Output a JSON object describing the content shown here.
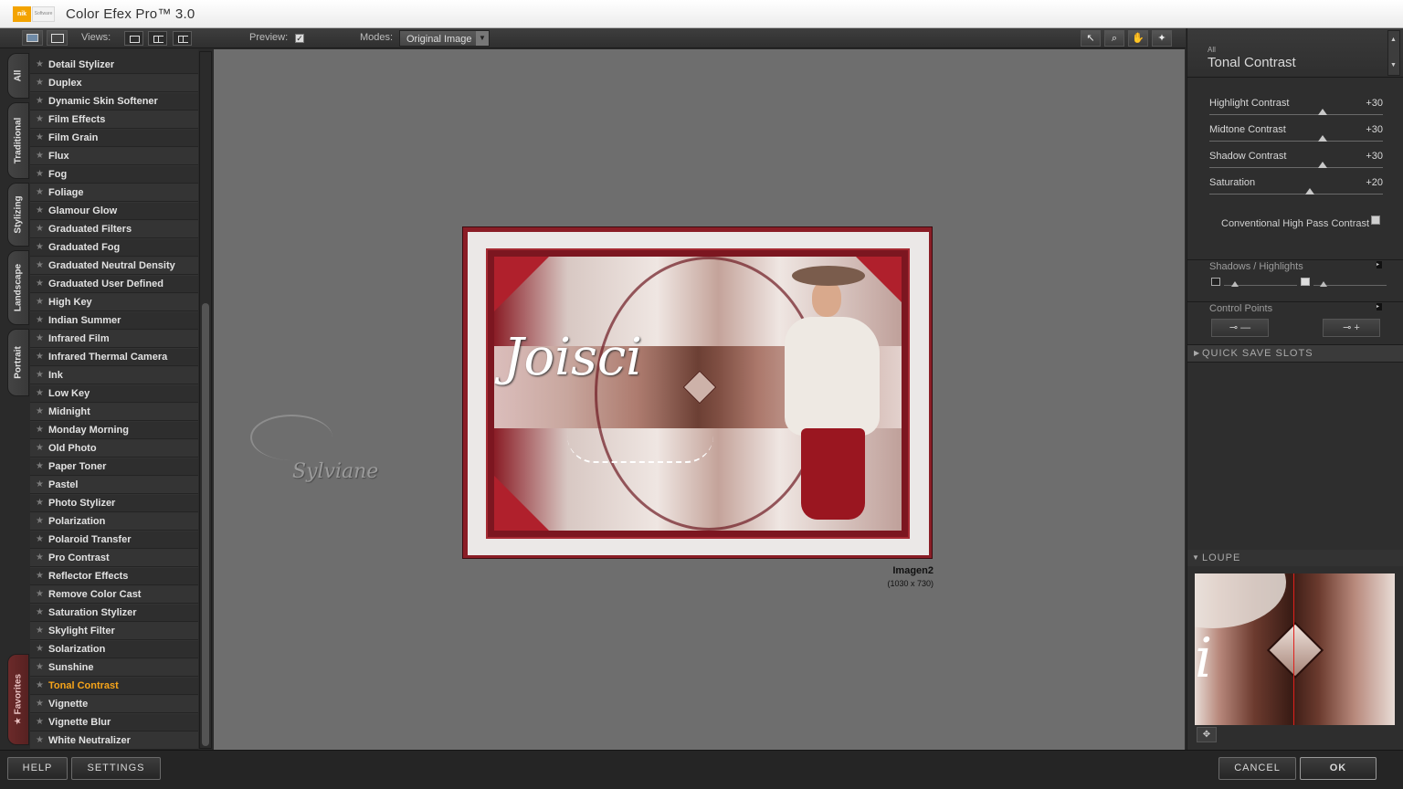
{
  "app": {
    "title": "Color Efex Pro™ 3.0",
    "logo_text": "nik",
    "logo_sub": "Software"
  },
  "toolbar": {
    "views_label": "Views:",
    "preview_label": "Preview:",
    "preview_checked": true,
    "modes_label": "Modes:",
    "modes_value": "Original Image"
  },
  "tabs": [
    "All",
    "Traditional",
    "Stylizing",
    "Landscape",
    "Portrait",
    "Favorites"
  ],
  "filters": [
    "Detail Stylizer",
    "Duplex",
    "Dynamic Skin Softener",
    "Film Effects",
    "Film Grain",
    "Flux",
    "Fog",
    "Foliage",
    "Glamour Glow",
    "Graduated Filters",
    "Graduated Fog",
    "Graduated Neutral Density",
    "Graduated User Defined",
    "High Key",
    "Indian Summer",
    "Infrared Film",
    "Infrared Thermal Camera",
    "Ink",
    "Low Key",
    "Midnight",
    "Monday Morning",
    "Old Photo",
    "Paper Toner",
    "Pastel",
    "Photo Stylizer",
    "Polarization",
    "Polaroid Transfer",
    "Pro Contrast",
    "Reflector Effects",
    "Remove Color Cast",
    "Saturation Stylizer",
    "Skylight Filter",
    "Solarization",
    "Sunshine",
    "Tonal Contrast",
    "Vignette",
    "Vignette Blur",
    "White Neutralizer"
  ],
  "active_filter": "Tonal Contrast",
  "canvas": {
    "image_name": "Imagen2",
    "image_size": "(1030 x 730)",
    "signature_text": "Joisci",
    "watermark_text": "Sylviane"
  },
  "panel": {
    "category": "All",
    "title": "Tonal Contrast",
    "sliders": [
      {
        "label": "Highlight Contrast",
        "value": "+30",
        "level": 0.65
      },
      {
        "label": "Midtone Contrast",
        "value": "+30",
        "level": 0.65
      },
      {
        "label": "Shadow Contrast",
        "value": "+30",
        "level": 0.65
      },
      {
        "label": "Saturation",
        "value": "+20",
        "level": 0.58
      }
    ],
    "checkbox_label": "Conventional High Pass Contrast",
    "shadows_highlights_label": "Shadows / Highlights",
    "control_points_label": "Control Points",
    "cp_minus": "—",
    "cp_plus": "+",
    "quick_save_label": "QUICK SAVE SLOTS",
    "loupe_label": "LOUPE"
  },
  "bottom": {
    "help": "HELP",
    "settings": "SETTINGS",
    "cancel": "CANCEL",
    "ok": "OK"
  },
  "colors": {
    "accent": "#f6a41a",
    "frame": "#8a1d26",
    "canvas_bg": "#6e6e6e"
  }
}
